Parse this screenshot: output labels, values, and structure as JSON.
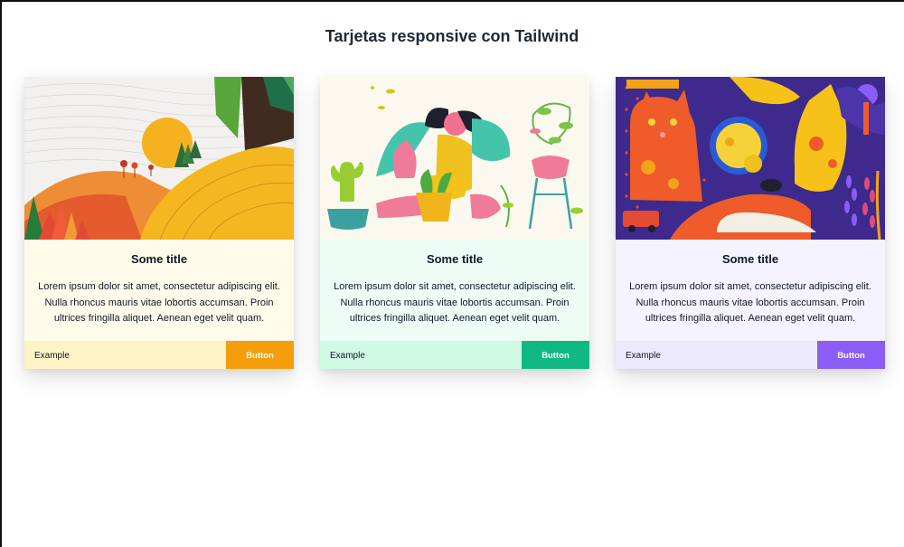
{
  "page": {
    "title": "Tarjetas responsive con Tailwind"
  },
  "cards": [
    {
      "image_name": "landscape-hills-illustration",
      "title": "Some title",
      "text": "Lorem ipsum dolor sit amet, consectetur adipiscing elit. Nulla rhoncus mauris vitae lobortis accumsan. Proin ultrices fringilla aliquet. Aenean eget velit quam.",
      "footer_label": "Example",
      "button_label": "Button",
      "accent": "#f59e0b",
      "body_bg": "#fefbea",
      "footer_bg": "#fef3c7"
    },
    {
      "image_name": "person-with-plants-illustration",
      "title": "Some title",
      "text": "Lorem ipsum dolor sit amet, consectetur adipiscing elit. Nulla rhoncus mauris vitae lobortis accumsan. Proin ultrices fringilla aliquet. Aenean eget velit quam.",
      "footer_label": "Example",
      "button_label": "Button",
      "accent": "#10b981",
      "body_bg": "#edfdf6",
      "footer_bg": "#d1fae5"
    },
    {
      "image_name": "cats-and-fishbowl-illustration",
      "title": "Some title",
      "text": "Lorem ipsum dolor sit amet, consectetur adipiscing elit. Nulla rhoncus mauris vitae lobortis accumsan. Proin ultrices fringilla aliquet. Aenean eget velit quam.",
      "footer_label": "Example",
      "button_label": "Button",
      "accent": "#8b5cf6",
      "body_bg": "#f5f3ff",
      "footer_bg": "#ede9fe"
    }
  ]
}
